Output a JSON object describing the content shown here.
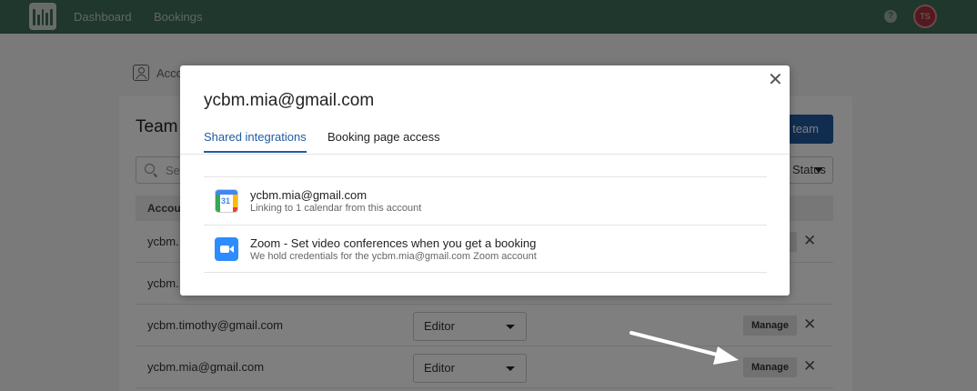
{
  "topnav": {
    "logo": "logo-icon",
    "links": [
      "Dashboard",
      "Bookings"
    ],
    "help_label": "?",
    "avatar_initials": "TS"
  },
  "page": {
    "breadcrumb": "Account",
    "title": "Team",
    "add_button_label": "Add team members",
    "search_placeholder": "Search",
    "status_filter_label": "Status",
    "table_header": "Account",
    "rows": [
      {
        "account": "ycbm.",
        "role": "",
        "manage": ""
      },
      {
        "account": "ycbm.",
        "role": "",
        "manage": ""
      },
      {
        "account": "ycbm.timothy@gmail.com",
        "role": "Editor",
        "manage": "Manage"
      },
      {
        "account": "ycbm.mia@gmail.com",
        "role": "Editor",
        "manage": "Manage"
      }
    ],
    "remove_glyph": "✕"
  },
  "modal": {
    "title": "ycbm.mia@gmail.com",
    "close_glyph": "✕",
    "tabs": [
      {
        "label": "Shared integrations",
        "active": true
      },
      {
        "label": "Booking page access",
        "active": false
      }
    ],
    "integrations": [
      {
        "icon": "google-calendar-icon",
        "icon_text": "31",
        "title": "ycbm.mia@gmail.com",
        "subtitle": "Linking to 1 calendar from this account"
      },
      {
        "icon": "zoom-icon",
        "title": "Zoom - Set video conferences when you get a booking",
        "subtitle": "We hold credentials for the ycbm.mia@gmail.com Zoom account"
      }
    ]
  },
  "colors": {
    "topbar": "#3e6f58",
    "accent": "#215ba1",
    "overlay": "rgba(0,0,0,0.5)"
  }
}
